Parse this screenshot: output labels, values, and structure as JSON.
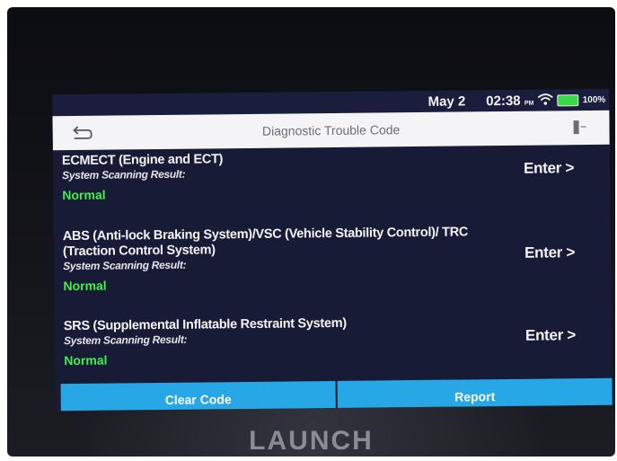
{
  "status_bar": {
    "date": "May 2",
    "time": "02:38",
    "ampm": "PM",
    "battery": "100%",
    "icons": [
      "wifi-icon",
      "battery-icon"
    ]
  },
  "header": {
    "title": "Diagnostic Trouble Code",
    "back_icon": "back-arrow-icon",
    "exit_icon": "exit-icon"
  },
  "systems": [
    {
      "name": "ECMECT (Engine and ECT)",
      "result_label": "System Scanning Result:",
      "status": "Normal",
      "action": "Enter >"
    },
    {
      "name": "ABS (Anti-lock Braking System)/VSC (Vehicle Stability Control)/ TRC (Traction Control System)",
      "result_label": "System Scanning Result:",
      "status": "Normal",
      "action": "Enter >"
    },
    {
      "name": "SRS (Supplemental Inflatable Restraint System)",
      "result_label": "System Scanning Result:",
      "status": "Normal",
      "action": "Enter >"
    }
  ],
  "buttons": {
    "clear_code": "Clear Code",
    "report": "Report"
  },
  "brand": "LAUNCH",
  "colors": {
    "screen_bg": "#181b36",
    "normal_status": "#41f04a",
    "button_bg": "#27a7e6",
    "title_bar_bg": "#f4f4f6"
  }
}
